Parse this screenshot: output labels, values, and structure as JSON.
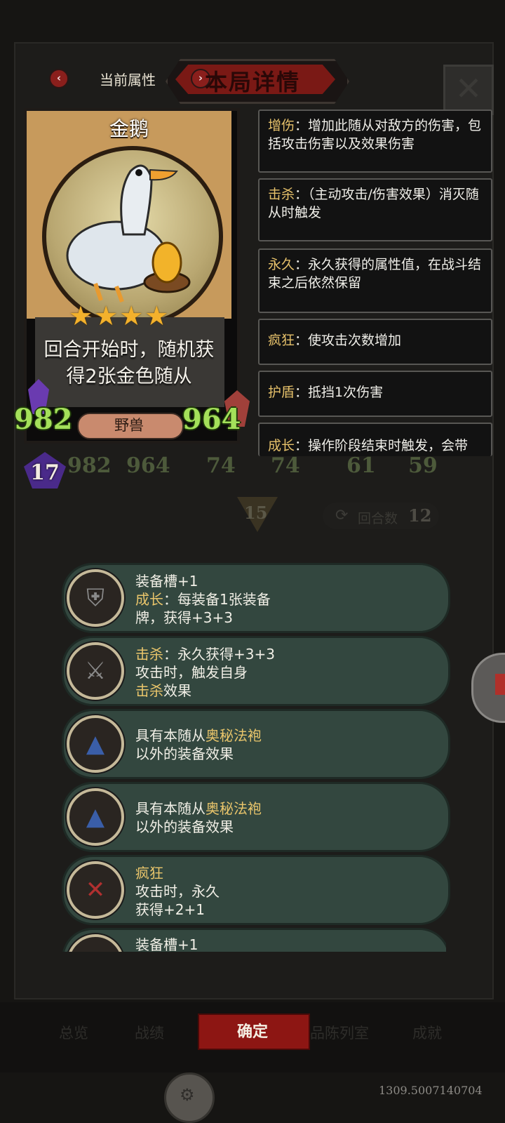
{
  "header": {
    "left_tab_label": "当前属性",
    "active_tab_label": "本局详情",
    "prev_arrow": "‹",
    "next_arrow": "›",
    "close_glyph": "✕"
  },
  "card": {
    "name": "金鹅",
    "stars": "★★★★",
    "description_line1": "回合开始时，随机获",
    "description_line2": "得2张金色随从",
    "attack": "982",
    "health": "964",
    "tribe": "野兽",
    "level": "17"
  },
  "keywords": [
    {
      "name": "增伤",
      "text": "：增加此随从对敌方的伤害，包括攻击伤害以及效果伤害"
    },
    {
      "name": "击杀",
      "text": "：（主动攻击/伤害效果）消灭随从时触发"
    },
    {
      "name": "永久",
      "text": "：永久获得的属性值，在战斗结束之后依然保留"
    },
    {
      "name": "疯狂",
      "text": "：使攻击次数增加"
    },
    {
      "name": "护盾",
      "text": "：抵挡1次伤害"
    },
    {
      "name": "成长",
      "text": "：操作阶段结束时触发，会带"
    }
  ],
  "background": {
    "stats": [
      "982",
      "964",
      "74",
      "74",
      "61",
      "59"
    ],
    "arrow_count": "15",
    "round_label": "回合数",
    "round_value": "12"
  },
  "equipment": [
    {
      "icon": "armor-icon",
      "line1": "装备槽+1",
      "line2_key": "成长",
      "line2_rest": "：每装备1张装备",
      "line3": "牌，获得+3+3"
    },
    {
      "icon": "scythe-icon",
      "line1_key": "击杀",
      "line1_rest": "：永久获得+3+3",
      "line2": "攻击时，触发自身",
      "line3_key": "击杀",
      "line3_rest": "效果"
    },
    {
      "icon": "robe-icon",
      "line1_pre": "具有本随从",
      "line1_key": "奥秘法袍",
      "line2": "以外的装备效果"
    },
    {
      "icon": "robe-icon",
      "line1_pre": "具有本随从",
      "line1_key": "奥秘法袍",
      "line2": "以外的装备效果"
    },
    {
      "icon": "crossed-swords-icon",
      "line1_key": "疯狂",
      "line2": "攻击时，永久",
      "line3": "获得+2+1"
    },
    {
      "icon": "armor-icon",
      "line1": "装备槽+1"
    }
  ],
  "bottom": {
    "tabs": [
      "总览",
      "战绩",
      "品陈列室",
      "成就"
    ],
    "confirm_label": "确定",
    "version": "1309.5007140704"
  },
  "colors": {
    "accent_red": "#8d1613",
    "keyword_gold": "#e5c06a",
    "stat_green": "#a4e05a",
    "panel_teal": "#33473f"
  }
}
